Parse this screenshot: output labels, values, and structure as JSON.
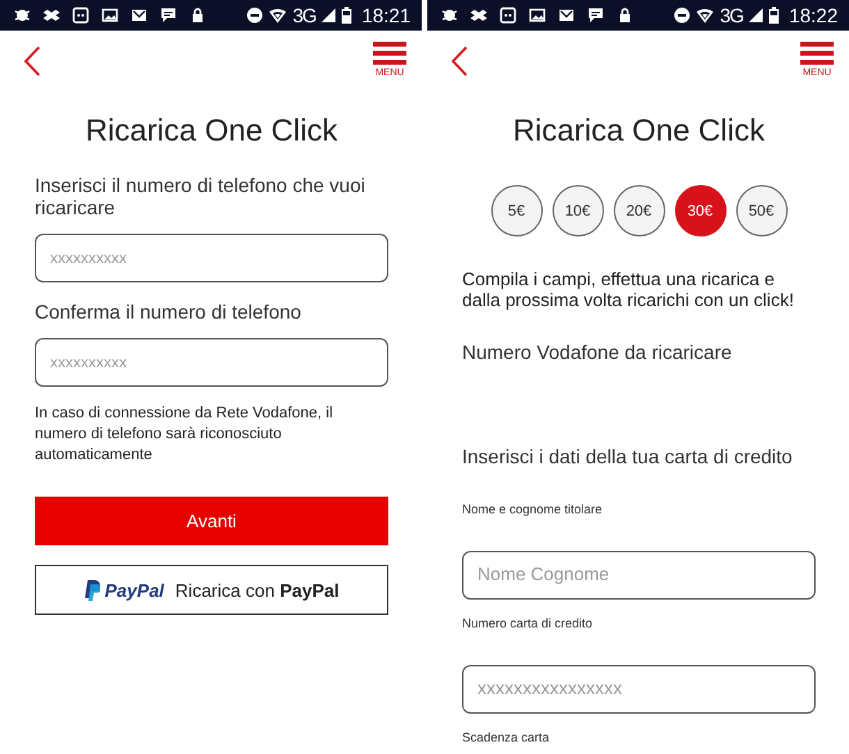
{
  "screens": [
    {
      "status_bar": {
        "network": "3G",
        "time": "18:21"
      },
      "menu_label": "MENU",
      "title": "Ricarica One Click",
      "blocks": [
        {
          "kind": "label",
          "text": "Inserisci il numero di telefono che vuoi ricaricare"
        },
        {
          "kind": "field",
          "placeholder": "xxxxxxxxxx"
        },
        {
          "kind": "label",
          "text": "Conferma il numero di telefono"
        },
        {
          "kind": "field",
          "placeholder": "xxxxxxxxxx"
        },
        {
          "kind": "note",
          "text": "In caso di connessione da Rete Vodafone, il numero di telefono sarà riconosciuto automaticamente"
        },
        {
          "kind": "primary-button",
          "text": "Avanti"
        },
        {
          "kind": "paypal-button",
          "logo": "PayPal",
          "text": "Ricarica con **PayPal**"
        }
      ]
    },
    {
      "status_bar": {
        "network": "3G",
        "time": "18:22"
      },
      "menu_label": "MENU",
      "title": "Ricarica One Click",
      "blocks": [
        {
          "kind": "amounts",
          "items": [
            {
              "label": "5€",
              "selected": false
            },
            {
              "label": "10€",
              "selected": false
            },
            {
              "label": "20€",
              "selected": false
            },
            {
              "label": "30€",
              "selected": true
            },
            {
              "label": "50€",
              "selected": false
            }
          ]
        },
        {
          "kind": "intro",
          "text": "Compila i campi, effettua una ricarica e dalla prossima volta ricarichi con un click!"
        },
        {
          "kind": "label",
          "text": "Numero Vodafone da ricaricare"
        },
        {
          "kind": "heading",
          "text": "Inserisci i dati della tua carta di credito"
        },
        {
          "kind": "small-label",
          "text": "Nome e cognome titolare"
        },
        {
          "kind": "field",
          "placeholder": "Nome Cognome"
        },
        {
          "kind": "small-label",
          "text": "Numero carta di credito"
        },
        {
          "kind": "field",
          "placeholder": "xxxxxxxxxxxxxxxx"
        },
        {
          "kind": "small-label",
          "text": "Scadenza carta"
        }
      ]
    }
  ]
}
